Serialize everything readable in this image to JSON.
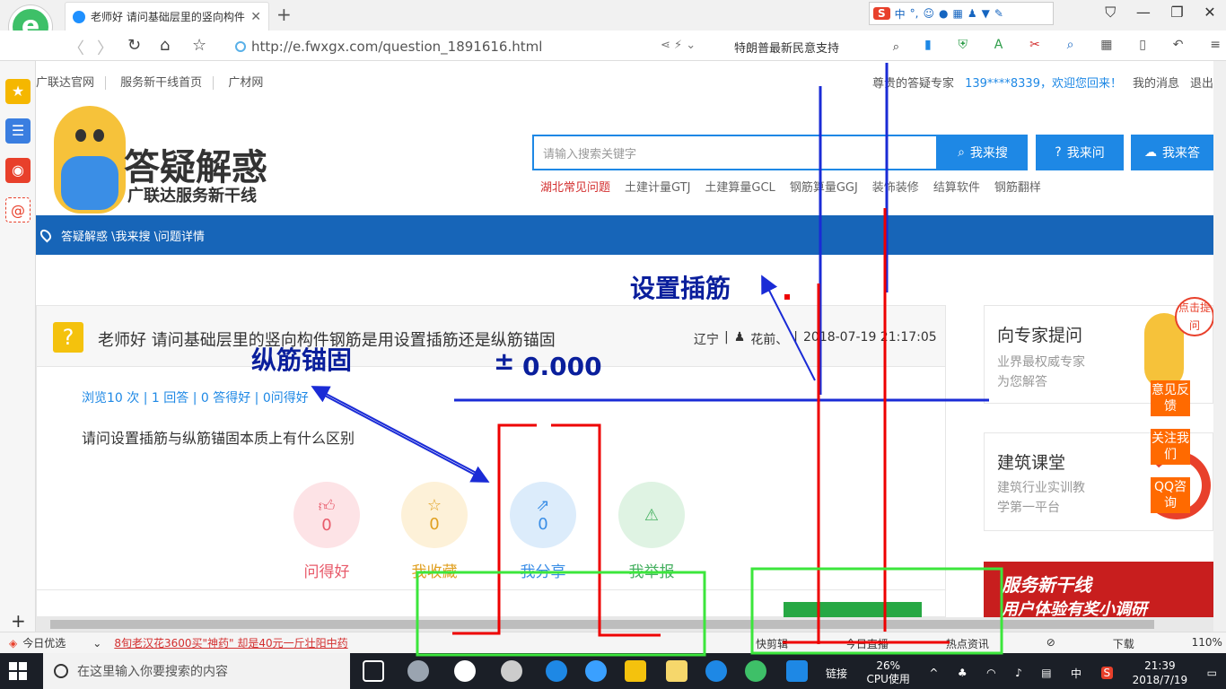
{
  "browser": {
    "tab_title": "老师好 请问基础层里的竖向构件",
    "new_tab": "+",
    "url": "http://e.fwxgx.com/question_1891616.html",
    "hot_search": "特朗普最新民意支持",
    "ime_label": "中",
    "ime_logo": "S"
  },
  "site": {
    "top_links": [
      "广联达官网",
      "服务新干线首页",
      "广材网"
    ],
    "greeting": "尊贵的答疑专家",
    "phone_greeting": "139****8339，欢迎您回来！",
    "my_messages": "我的消息",
    "logout": "退出",
    "logo_main": "答疑解惑",
    "logo_sub": "广联达服务新干线",
    "search_placeholder": "请输入搜索关键字",
    "btn_search": "我来搜",
    "btn_ask": "我来问",
    "btn_answer": "我来答",
    "hot_links": [
      "湖北常见问题",
      "土建计量GTJ",
      "土建算量GCL",
      "钢筋算量GGJ",
      "装饰装修",
      "结算软件",
      "钢筋翻样"
    ],
    "breadcrumb": "答疑解惑 \\我来搜 \\问题详情"
  },
  "question": {
    "title": "老师好 请问基础层里的竖向构件钢筋是用设置插筋还是纵筋锚固",
    "region": "辽宁",
    "user": "花前、",
    "datetime": "2018-07-19 21:17:05",
    "stats": "浏览10 次 | 1 回答 | 0 答得好 | 0问得好",
    "body": "请问设置插筋与纵筋锚固本质上有什么区别",
    "actions": [
      {
        "label": "问得好",
        "count": "0",
        "color": "#e85a6a",
        "bg": "#fde3e6"
      },
      {
        "label": "我收藏",
        "count": "0",
        "color": "#e0a020",
        "bg": "#fdf1d8"
      },
      {
        "label": "我分享",
        "count": "0",
        "color": "#3a8ee6",
        "bg": "#dcecfb"
      },
      {
        "label": "我举报",
        "count": "",
        "color": "#45b060",
        "bg": "#dff3e3"
      }
    ]
  },
  "side": {
    "expert_title": "向专家提问",
    "expert_sub1": "业界最权威专家",
    "expert_sub2": "为您解答",
    "feedback": "意见反馈",
    "follow": "关注我们",
    "qq": "QQ咨询",
    "bubble": "点击提问",
    "course_title": "建筑课堂",
    "course_sub1": "建筑行业实训教",
    "course_sub2": "学第一平台",
    "promo": "服务新干线",
    "promo_sub": "用户体验有奖小调研"
  },
  "annotations": {
    "chajin": "设置插筋",
    "zongjin": "纵筋锚固",
    "elev": "0.000",
    "plus": "±"
  },
  "statusbar": {
    "today": "今日优选",
    "news": "8旬老汉花3600买\"神药\" 却是40元一斤壮阳中药",
    "items": [
      "快剪辑",
      "今日直播",
      "热点资讯",
      "下载",
      "110%"
    ]
  },
  "taskbar": {
    "search": "在这里输入你要搜索的内容",
    "link": "链接",
    "cpu": "26%",
    "cpu_label": "CPU使用",
    "ime": "中",
    "time": "21:39",
    "date": "2018/7/19"
  }
}
